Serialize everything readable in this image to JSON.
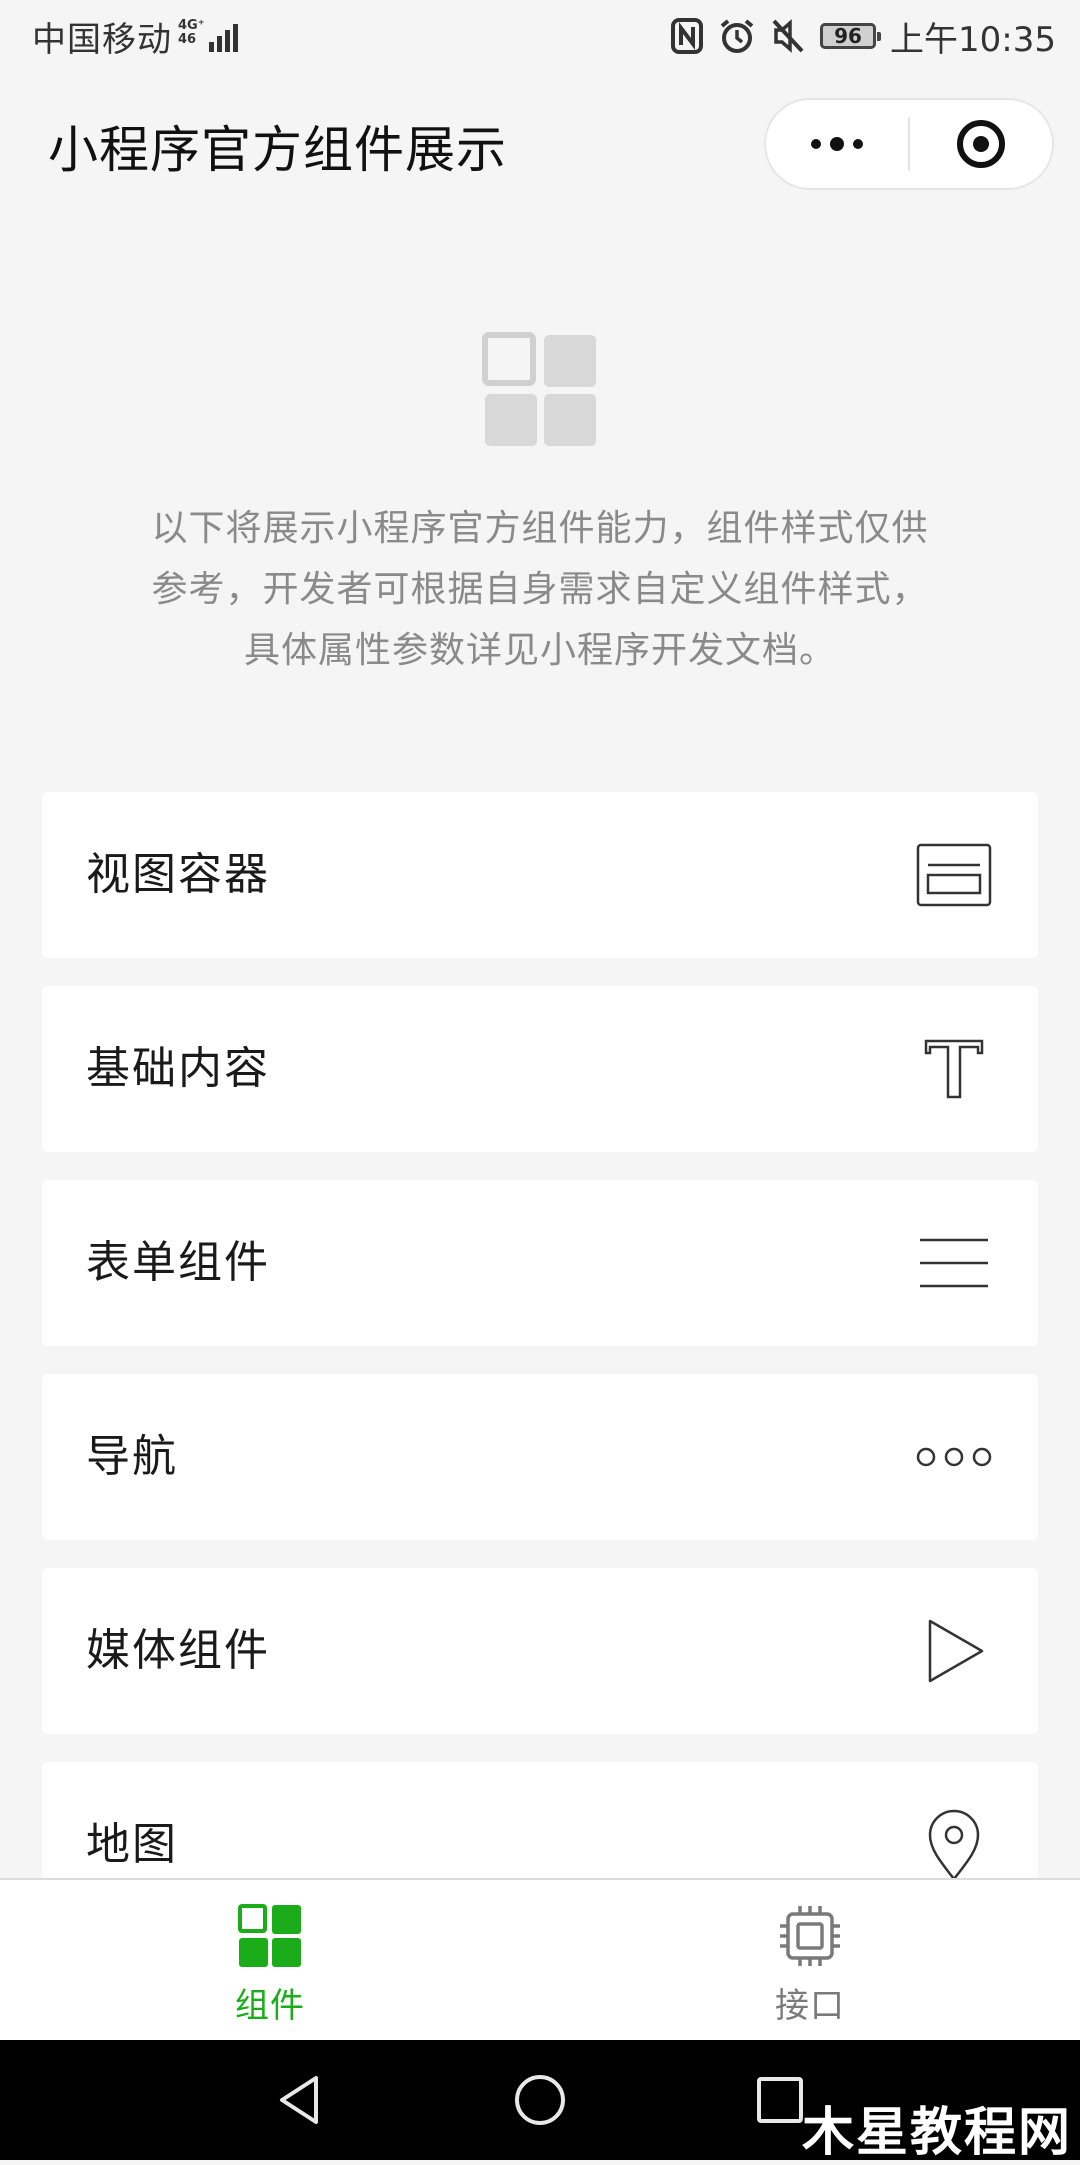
{
  "status_bar": {
    "carrier": "中国移动",
    "network_type_top": "4G⁺",
    "network_type_bottom": "46",
    "battery_level": "96",
    "time": "上午10:35",
    "icons": [
      "nfc-icon",
      "alarm-icon",
      "mute-icon",
      "battery-icon"
    ]
  },
  "nav": {
    "title": "小程序官方组件展示",
    "more_icon": "more-dots-icon",
    "close_icon": "target-close-icon"
  },
  "intro": {
    "logo_icon": "component-grid-icon",
    "lines": [
      "以下将展示小程序官方组件能力，组件样式仅供",
      "参考，开发者可根据自身需求自定义组件样式，",
      "具体属性参数详见小程序开发文档。"
    ]
  },
  "list": {
    "items": [
      {
        "label": "视图容器",
        "icon": "view-container-icon"
      },
      {
        "label": "基础内容",
        "icon": "text-t-icon"
      },
      {
        "label": "表单组件",
        "icon": "form-lines-icon"
      },
      {
        "label": "导航",
        "icon": "navigation-dots-icon"
      },
      {
        "label": "媒体组件",
        "icon": "play-icon"
      },
      {
        "label": "地图",
        "icon": "map-pin-icon"
      }
    ]
  },
  "tabbar": {
    "items": [
      {
        "label": "组件",
        "icon": "component-grid-icon",
        "active": true
      },
      {
        "label": "接口",
        "icon": "chip-icon",
        "active": false
      }
    ],
    "active_color": "#1aad19",
    "inactive_color": "#7a7a7a"
  },
  "system_nav": {
    "buttons": [
      "back-triangle-icon",
      "home-circle-icon",
      "recents-square-icon"
    ]
  },
  "watermark": "木星教程网"
}
